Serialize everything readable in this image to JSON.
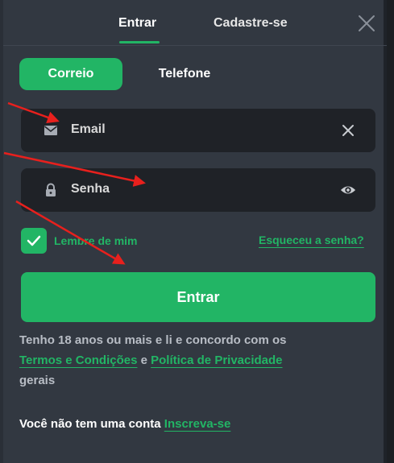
{
  "tabs": {
    "login": "Entrar",
    "register": "Cadastre-se"
  },
  "toggle": {
    "email": "Correio",
    "phone": "Telefone"
  },
  "email_field": {
    "value": "Email",
    "icon": "mail-icon",
    "clear_icon": "close-icon"
  },
  "password_field": {
    "value": "Senha",
    "icon": "lock-icon",
    "toggle_icon": "eye-icon"
  },
  "remember": {
    "label": "Lembre de mim",
    "checked": true
  },
  "forgot": "Esqueceu a senha?",
  "submit": "Entrar",
  "terms": {
    "prefix": "Tenho 18 anos ou mais e li e concordo com os",
    "terms_link": "Termos e Condições",
    "and": "e",
    "privacy_link": "Política de Privacidade",
    "suffix": "gerais"
  },
  "signup": {
    "prompt": "Você não tem uma conta",
    "link": "Inscreva-se"
  },
  "colors": {
    "accent": "#22b565",
    "panel": "#323841",
    "field": "#1f2227",
    "annotation": "#e8201d"
  }
}
